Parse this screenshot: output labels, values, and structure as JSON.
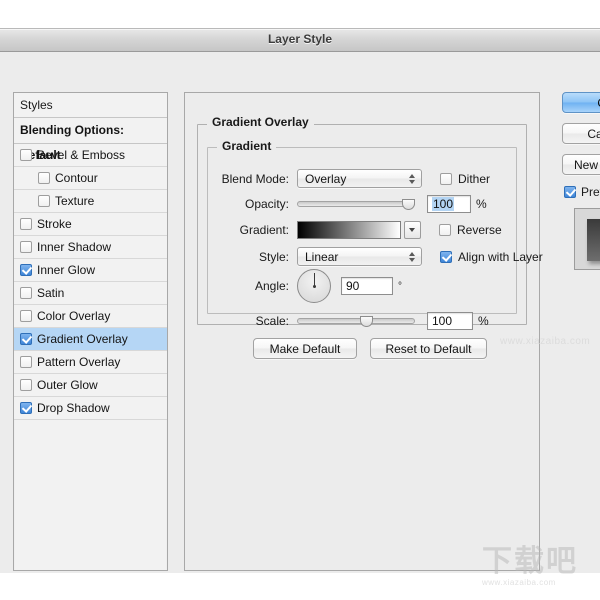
{
  "window": {
    "title": "Layer Style"
  },
  "styles_panel": {
    "header": "Styles",
    "blending_options": "Blending Options: Default",
    "items": [
      {
        "label": "Bevel & Emboss",
        "checked": false,
        "indent": false,
        "selected": false
      },
      {
        "label": "Contour",
        "checked": false,
        "indent": true,
        "selected": false
      },
      {
        "label": "Texture",
        "checked": false,
        "indent": true,
        "selected": false
      },
      {
        "label": "Stroke",
        "checked": false,
        "indent": false,
        "selected": false
      },
      {
        "label": "Inner Shadow",
        "checked": false,
        "indent": false,
        "selected": false
      },
      {
        "label": "Inner Glow",
        "checked": true,
        "indent": false,
        "selected": false
      },
      {
        "label": "Satin",
        "checked": false,
        "indent": false,
        "selected": false
      },
      {
        "label": "Color Overlay",
        "checked": false,
        "indent": false,
        "selected": false
      },
      {
        "label": "Gradient Overlay",
        "checked": true,
        "indent": false,
        "selected": true
      },
      {
        "label": "Pattern Overlay",
        "checked": false,
        "indent": false,
        "selected": false
      },
      {
        "label": "Outer Glow",
        "checked": false,
        "indent": false,
        "selected": false
      },
      {
        "label": "Drop Shadow",
        "checked": true,
        "indent": false,
        "selected": false
      }
    ]
  },
  "main_panel": {
    "section_title": "Gradient Overlay",
    "group_title": "Gradient",
    "blend_mode": {
      "label": "Blend Mode:",
      "value": "Overlay"
    },
    "dither": {
      "label": "Dither",
      "checked": false
    },
    "opacity": {
      "label": "Opacity:",
      "value": "100",
      "unit": "%",
      "slider_percent": 100,
      "selected": true
    },
    "gradient": {
      "label": "Gradient:",
      "from_color": "#000000",
      "to_color": "#ffffff"
    },
    "reverse": {
      "label": "Reverse",
      "checked": false
    },
    "style": {
      "label": "Style:",
      "value": "Linear"
    },
    "align_with_layer": {
      "label": "Align with Layer",
      "checked": true
    },
    "angle": {
      "label": "Angle:",
      "value": "90",
      "unit": "°"
    },
    "scale": {
      "label": "Scale:",
      "value": "100",
      "unit": "%",
      "slider_percent": 60
    },
    "make_default": "Make Default",
    "reset_to_default": "Reset to Default"
  },
  "right_buttons": {
    "ok": "OK",
    "cancel": "Cancel",
    "new_style": "New Style...",
    "preview": {
      "label": "Preview",
      "checked": true
    }
  },
  "watermark": {
    "site_text": "www.xiazaiba.com",
    "logo_text": "下载吧",
    "logo_url": "www.xiazaiba.com"
  },
  "colors": {
    "accent": "#b5d6f5",
    "default_button": "#8dc4f6",
    "window_bg": "#ececec"
  }
}
